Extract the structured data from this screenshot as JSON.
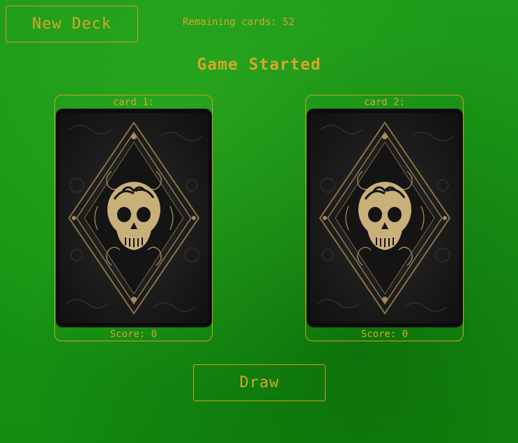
{
  "toolbar": {
    "new_deck_label": "New Deck",
    "remaining_label": "Remaining cards:",
    "remaining_count": "52"
  },
  "status_text": "Game Started",
  "cards": [
    {
      "title": "card 1:",
      "score_text": "Score: 0",
      "face": "card-back"
    },
    {
      "title": "card 2:",
      "score_text": "Score: 0",
      "face": "card-back"
    }
  ],
  "actions": {
    "draw_label": "Draw"
  },
  "colors": {
    "table_green": "#1a9716",
    "accent_gold": "#d4a72c",
    "card_back_dark": "#0b0b0b",
    "card_ornament": "#a68c55"
  }
}
